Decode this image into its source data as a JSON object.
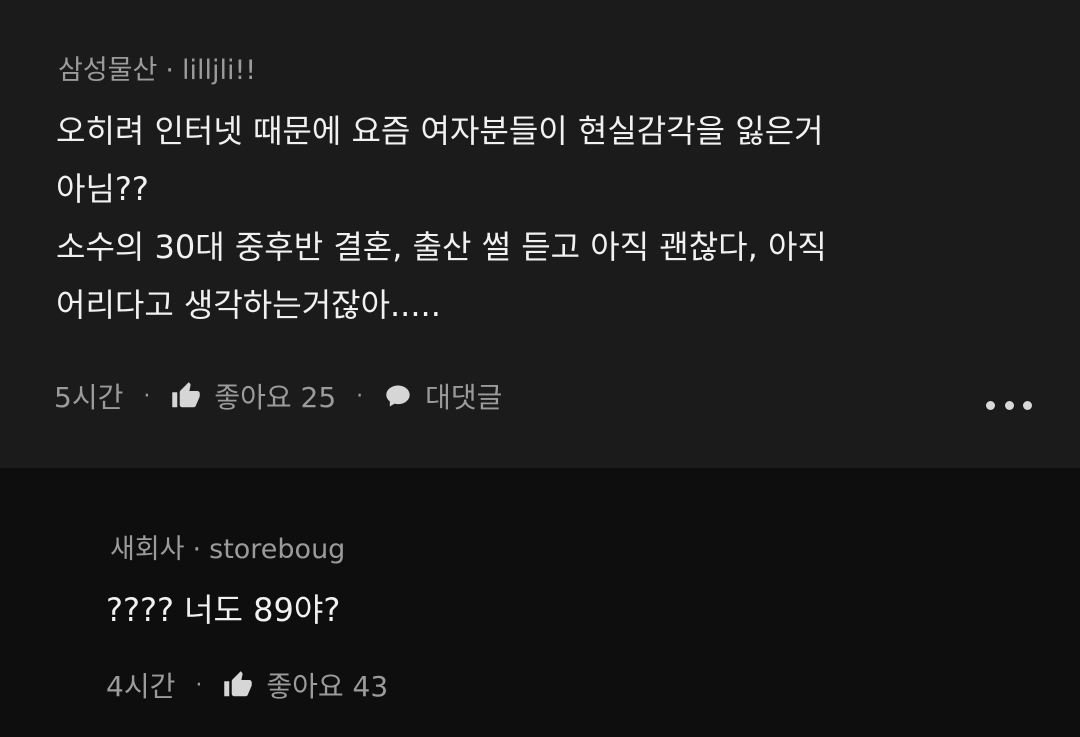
{
  "comments": [
    {
      "company": "삼성물산",
      "username": "lilljli!!",
      "lines": [
        "오히려 인터넷 때문에 요즘 여자분들이 현실감각을 잃은거",
        "아님??",
        "소수의 30대 중후반 결혼, 출산 썰 듣고 아직 괜찮다, 아직",
        "어리다고 생각하는거잖아....."
      ],
      "time": "5시간",
      "like_label": "좋아요 25",
      "reply_label": "대댓글"
    },
    {
      "company": "새회사",
      "username": "storeboug",
      "lines": [
        "???? 너도 89야?"
      ],
      "time": "4시간",
      "like_label": "좋아요 43"
    }
  ],
  "icons": {
    "like": "thumbs-up-icon",
    "reply": "speech-bubble-icon",
    "more": "more-icon"
  },
  "colors": {
    "main_bg": "#1b1b1b",
    "reply_bg": "#0e0e0e",
    "text": "#f1f1f1",
    "meta": "#9b9b9b"
  },
  "separator": "·"
}
